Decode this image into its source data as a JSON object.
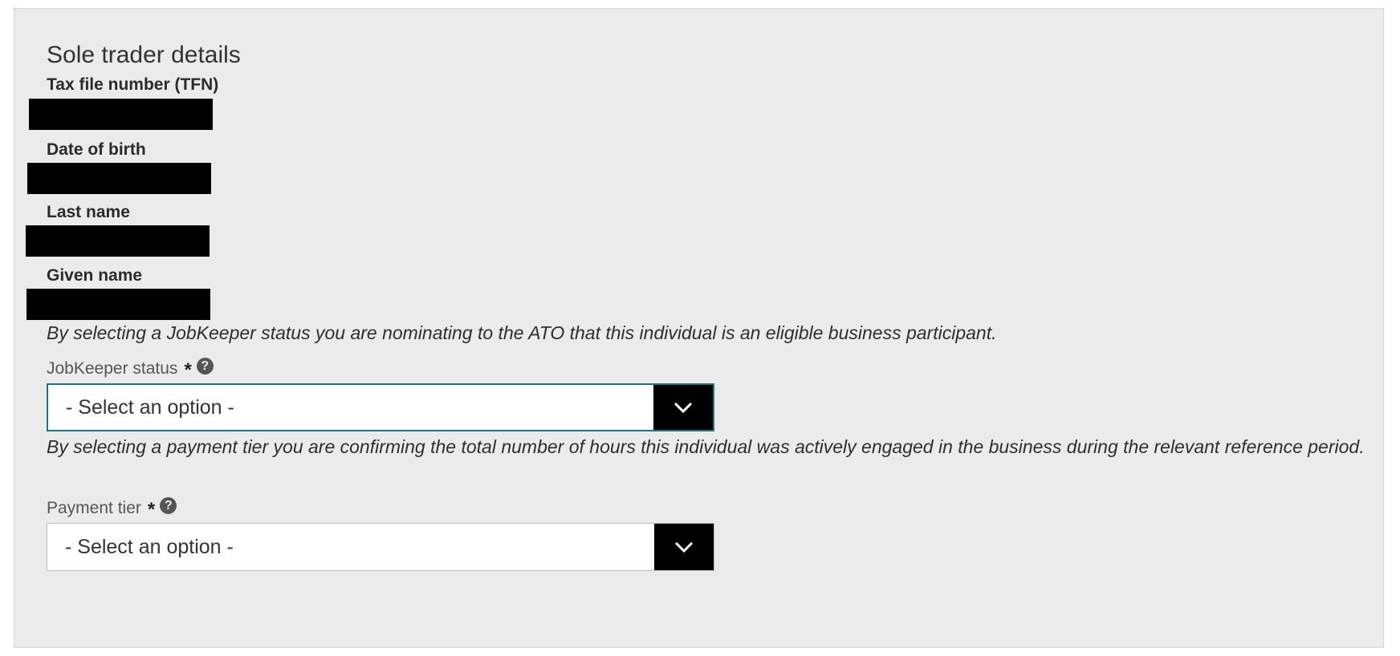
{
  "section": {
    "title": "Sole trader details"
  },
  "fields": {
    "tfn_label": "Tax file number (TFN)",
    "dob_label": "Date of birth",
    "last_name_label": "Last name",
    "given_name_label": "Given name"
  },
  "notes": {
    "jobkeeper_note": "By selecting a JobKeeper status you are nominating to the ATO that this individual is an eligible business participant.",
    "payment_note": "By selecting a payment tier you are confirming the total number of hours this individual was actively engaged in the business during the relevant reference period."
  },
  "jobkeeper_status": {
    "label": "JobKeeper status",
    "required_marker": "*",
    "help_glyph": "?",
    "selected_value": "- Select an option -"
  },
  "payment_tier": {
    "label": "Payment tier",
    "required_marker": "*",
    "help_glyph": "?",
    "selected_value": "- Select an option -"
  },
  "icons": {
    "help": "question-circle-icon",
    "dropdown": "chevron-down-icon"
  },
  "colors": {
    "panel_bg": "#ebebeb",
    "focus_border": "#137a7f",
    "dropdown_button": "#000000",
    "redaction": "#000000"
  }
}
